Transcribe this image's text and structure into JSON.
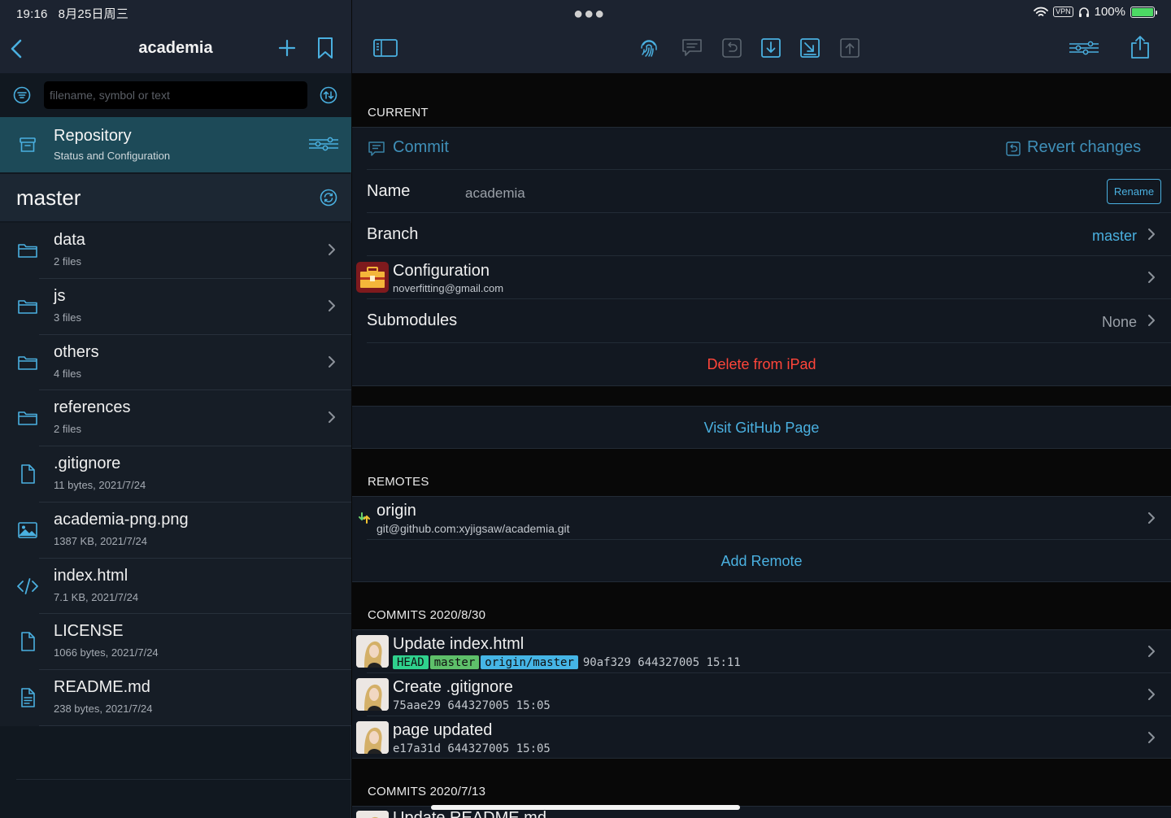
{
  "status": {
    "time": "19:16",
    "date": "8月25日周三",
    "vpn": "VPN",
    "battery": "100%"
  },
  "left": {
    "nav_title": "academia",
    "search_placeholder": "filename, symbol or text",
    "repository": {
      "title": "Repository",
      "subtitle": "Status and Configuration"
    },
    "branch": "master",
    "files": [
      {
        "name": "data",
        "meta": "2 files",
        "icon": "folder-icon"
      },
      {
        "name": "js",
        "meta": "3 files",
        "icon": "folder-icon"
      },
      {
        "name": "others",
        "meta": "4 files",
        "icon": "folder-icon"
      },
      {
        "name": "references",
        "meta": "2 files",
        "icon": "folder-icon"
      },
      {
        "name": ".gitignore",
        "meta": "11 bytes, 2021/7/24",
        "icon": "file-icon"
      },
      {
        "name": "academia-png.png",
        "meta": "1387 KB, 2021/7/24",
        "icon": "image-icon"
      },
      {
        "name": "index.html",
        "meta": "7.1 KB, 2021/7/24",
        "icon": "code-icon"
      },
      {
        "name": "LICENSE",
        "meta": "1066 bytes, 2021/7/24",
        "icon": "file-icon"
      },
      {
        "name": "README.md",
        "meta": "238 bytes, 2021/7/24",
        "icon": "text-file-icon"
      }
    ]
  },
  "right": {
    "current_label": "CURRENT",
    "commit_label": "Commit",
    "revert_label": "Revert changes",
    "name_label": "Name",
    "name_value": "academia",
    "rename_label": "Rename",
    "branch_label": "Branch",
    "branch_value": "master",
    "config_label": "Configuration",
    "config_email": "noverfitting@gmail.com",
    "submodules_label": "Submodules",
    "submodules_value": "None",
    "delete_label": "Delete from iPad",
    "visit_label": "Visit GitHub Page",
    "remotes_label": "REMOTES",
    "remote_name": "origin",
    "remote_url": "git@github.com:xyjigsaw/academia.git",
    "add_remote_label": "Add Remote",
    "commits_group1": "COMMITS 2020/8/30",
    "commits": [
      {
        "title": "Update index.html",
        "badges": [
          "HEAD",
          "master",
          "origin/master"
        ],
        "meta": "90af329 644327005 15:11"
      },
      {
        "title": "Create .gitignore",
        "badges": [],
        "meta": "75aae29 644327005 15:05"
      },
      {
        "title": "page updated",
        "badges": [],
        "meta": "e17a31d 644327005 15:05"
      }
    ],
    "commits_group2": "COMMITS 2020/7/13",
    "partial_commit_title": "Update README.md"
  },
  "colors": {
    "accent": "#4ab0e0",
    "selected_row": "#1d4a58",
    "delete": "#ff453a",
    "badge_head": "#2fd18d",
    "badge_master": "#5ec06a",
    "badge_origin": "#45b5e6"
  }
}
